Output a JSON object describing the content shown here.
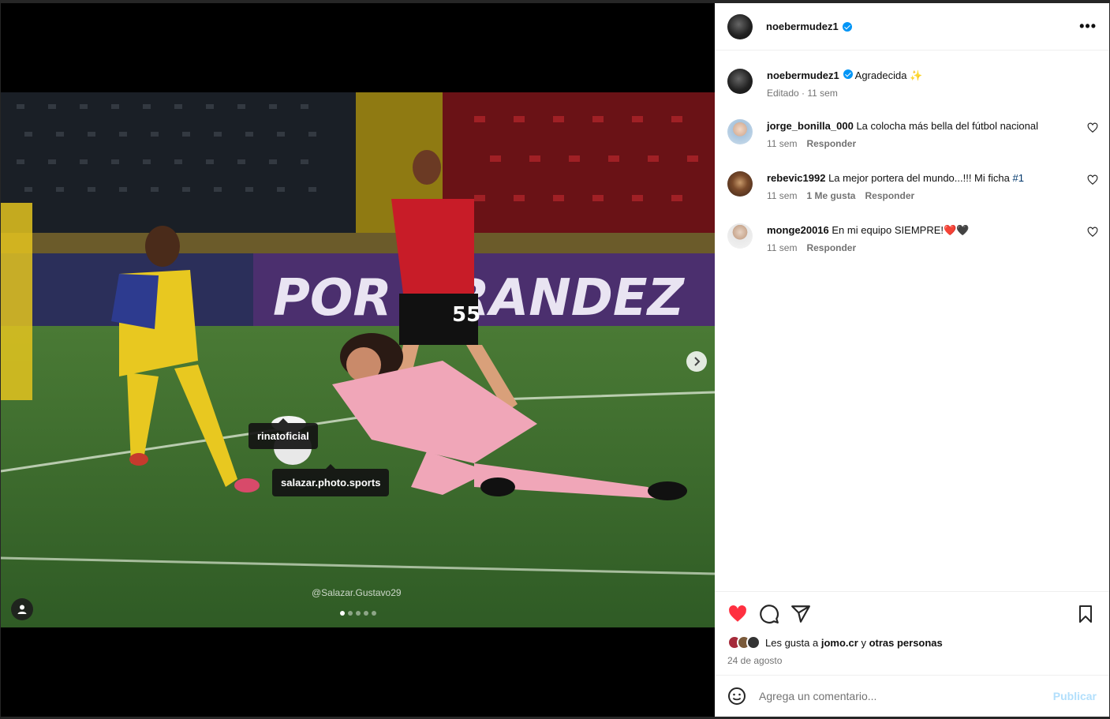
{
  "post": {
    "username": "noebermudez1",
    "caption": "Agradecida",
    "caption_emoji": "✨",
    "edited_label": "Editado",
    "time": "11 sem",
    "more_icon": "more-horizontal-icon"
  },
  "media": {
    "tags": [
      "rinatoficial",
      "salazar.photo.sports"
    ],
    "watermark": "@Salazar.Gustavo29",
    "banner_text": "POR GRANDEZ",
    "player_number": "55",
    "carousel_count": 5,
    "carousel_active": 1
  },
  "comments": [
    {
      "user": "jorge_bonilla_000",
      "text": "La colocha más bella del fútbol nacional",
      "time": "11 sem",
      "likes_label": "",
      "reply_label": "Responder"
    },
    {
      "user": "rebevic1992",
      "text": "La mejor portera del mundo...!!! Mi ficha ",
      "hashtag": "#1",
      "time": "11 sem",
      "likes_label": "1 Me gusta",
      "reply_label": "Responder"
    },
    {
      "user": "monge20016",
      "text": "En mi equipo SIEMPRE!",
      "emojis": "❤️🖤",
      "time": "11 sem",
      "likes_label": "",
      "reply_label": "Responder"
    }
  ],
  "actions": {
    "liked": true,
    "likes_prefix": "Les gusta a",
    "likes_user": "jomo.cr",
    "likes_connector": "y",
    "likes_others": "otras personas",
    "date": "24 de agosto"
  },
  "comment_box": {
    "placeholder": "Agrega un comentario...",
    "publish_label": "Publicar"
  },
  "colors": {
    "accent": "#0095f6",
    "like_red": "#ff3040",
    "publish_disabled": "#b2dffc"
  }
}
